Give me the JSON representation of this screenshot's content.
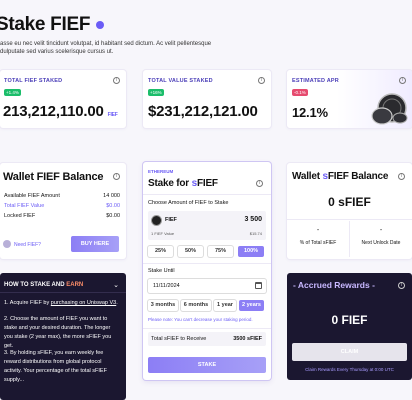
{
  "page": {
    "title": "Stake FIEF",
    "subtitle_line1": "asse eu nec velit tincidunt volutpat, id habitant sed dictum. Ac velit pellentesque",
    "subtitle_line2": "dulputate sed varius scelerisque cursus ut."
  },
  "stats": {
    "total_fief": {
      "label": "TOTAL FIEF STAKED",
      "change": "+1.4%",
      "value": "213,212,110.00",
      "unit": "FIEF"
    },
    "total_value": {
      "label": "TOTAL VALUE STAKED",
      "change": "+16%",
      "value": "$231,212,121.00"
    },
    "apr": {
      "label": "ESTIMATED APR",
      "change": "-0.1%",
      "value": "12.1%"
    }
  },
  "wallet": {
    "title": "Wallet FIEF Balance",
    "rows": [
      {
        "label": "Available FIEF Amount",
        "value": "14 000"
      },
      {
        "label": "Total FIEF Value",
        "value": "$0.00"
      },
      {
        "label": "Locked FIEF",
        "value": "$0.00"
      }
    ],
    "need_label": "Need FIEF?",
    "buy_button": "BUY HERE"
  },
  "howto": {
    "title_prefix": "HOW TO STAKE AND ",
    "title_accent": "EARN",
    "step1_a": "1. Acquire FIEF by ",
    "step1_link": "purchasing on Uniswap V3",
    "step1_b": ".",
    "step2": "2. Choose the amount of FIEF you want to stake and your desired duration. The longer you stake (2 year max), the more sFIEF you get.",
    "step3": "3. By holding sFIEF, you earn weekly fee reward distributions from global protocol activity. Your percentage of the total sFIEF supply..."
  },
  "stake": {
    "network": "ETHEREUM",
    "title_prefix": "Stake for ",
    "title_s": "s",
    "title_suffix": "FIEF",
    "choose_label": "Choose Amount of FIEF to Stake",
    "token": "FIEF",
    "amount": "3 500",
    "token_value_label": "1 FIEF Value",
    "token_value": "$15.74",
    "percent_buttons": [
      "25%",
      "50%",
      "75%",
      "100%"
    ],
    "until_label": "Stake Until",
    "date": "11/11/2024",
    "duration_buttons": [
      "3 months",
      "6 months",
      "1 year",
      "2 years"
    ],
    "note": "Please note: You can't decrease your staking period.",
    "receive_label": "Total sFIEF to Receive",
    "receive_value": "3500 sFIEF",
    "stake_button": "STAKE"
  },
  "sfief": {
    "title_prefix": "Wallet ",
    "title_s": "s",
    "title_suffix": "FIEF Balance",
    "balance": "0 sFIEF",
    "pct_label": "% of Total sFIEF",
    "unlock_label": "Next Unlock Date",
    "pct_value": "-",
    "unlock_value": "-"
  },
  "rewards": {
    "title": "Accrued Rewards",
    "value": "0 FIEF",
    "claim_button": "CLAIM",
    "note": "Claim Rewards Every Thursday at 0:00 UTC"
  },
  "colors": {
    "accent": "#6b5cf6",
    "green": "#1bbd6a",
    "red": "#e64b6f",
    "dark": "#1b1730"
  }
}
